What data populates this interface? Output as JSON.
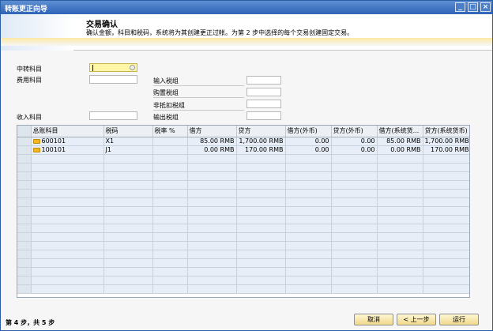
{
  "window": {
    "title": "转账更正向导"
  },
  "header": {
    "title": "交易确认",
    "description": "确认金额，科目和税码，系统将为其创建更正过帐。为第 2 步中选择的每个交易创建固定交易。"
  },
  "form": {
    "transit_account_label": "中转科目",
    "expense_account_label": "费用科目",
    "revenue_account_label": "收入科目",
    "input_tax_label": "输入税组",
    "purchase_tax_label": "购置税组",
    "non_deductible_tax_label": "非抵扣税组",
    "output_tax_label": "输出税组",
    "transit_account_value": "",
    "expense_account_value": "",
    "revenue_account_value": "",
    "input_tax_value": "",
    "purchase_tax_value": "",
    "non_deductible_tax_value": "",
    "output_tax_value": ""
  },
  "table": {
    "columns": [
      "总账科目",
      "税码",
      "税率 %",
      "借方",
      "贷方",
      "借方(外币)",
      "贷方(外币)",
      "借方(系统货...",
      "贷方(系统货币)"
    ],
    "rows": [
      [
        "600101",
        "X1",
        "",
        "85.00 RMB",
        "1,700.00 RMB",
        "0.00",
        "0.00",
        "85.00 RMB",
        "1,700.00 RMB"
      ],
      [
        "100101",
        "J1",
        "",
        "0.00 RMB",
        "170.00 RMB",
        "0.00",
        "0.00",
        "0.00 RMB",
        "170.00 RMB"
      ]
    ]
  },
  "footer": {
    "step_text": "第 4 步，共 5 步",
    "cancel_label": "取消",
    "prev_label": "< 上一步",
    "run_label": "运行"
  }
}
